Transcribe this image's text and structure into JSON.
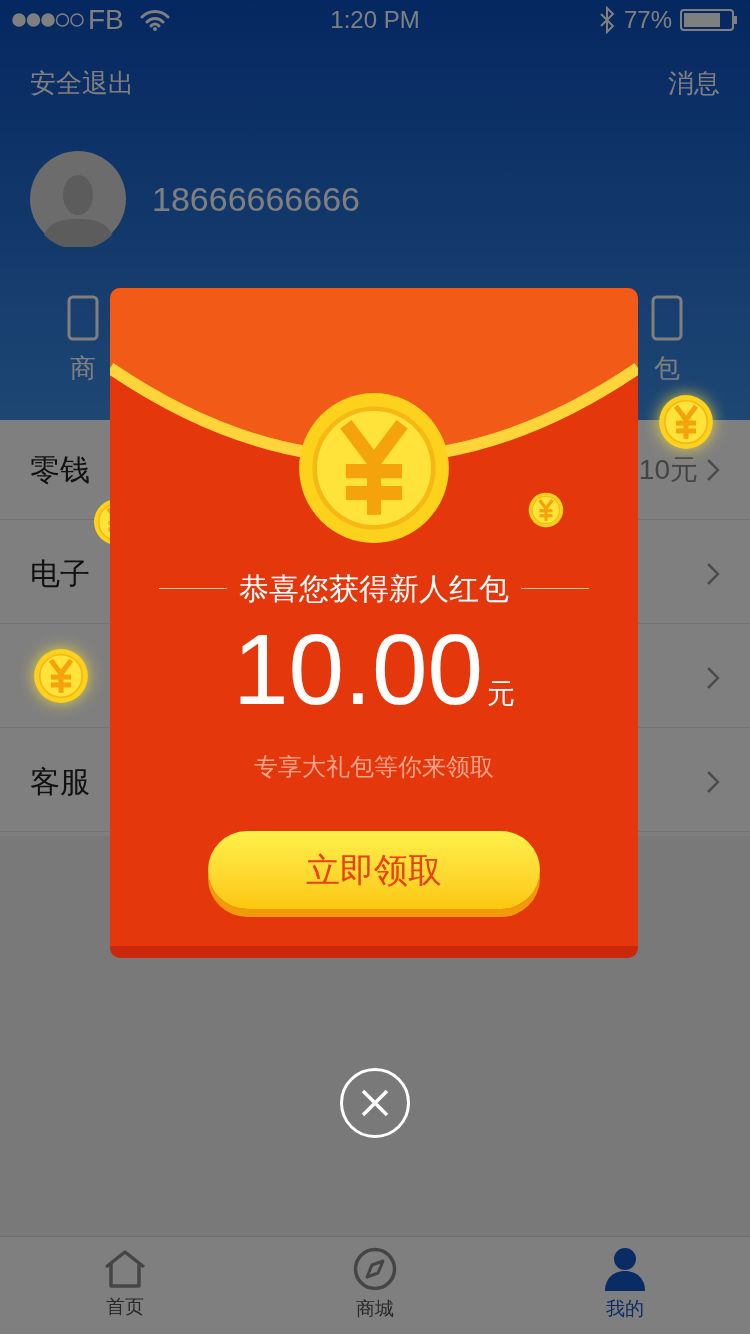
{
  "status_bar": {
    "carrier": "FB",
    "time": "1:20 PM",
    "battery": "77%"
  },
  "header": {
    "left_action": "安全退出",
    "right_action": "消息",
    "phone": "18666666666",
    "shortcuts": [
      {
        "label": "商"
      },
      {
        "label": "包"
      }
    ]
  },
  "menu": [
    {
      "label": "零钱",
      "value": "10元",
      "chevron": true
    },
    {
      "label": "电子",
      "chevron": true
    },
    {
      "chevron": true
    },
    {
      "label": "客服",
      "chevron": true
    }
  ],
  "popup": {
    "title": "恭喜您获得新人红包",
    "amount": "10.00",
    "unit": "元",
    "subtitle": "专享大礼包等你来领取",
    "button": "立即领取"
  },
  "tabs": [
    {
      "label": "首页",
      "selected": false,
      "kind": "home"
    },
    {
      "label": "商城",
      "selected": false,
      "kind": "compass"
    },
    {
      "label": "我的",
      "selected": true,
      "kind": "person"
    }
  ]
}
